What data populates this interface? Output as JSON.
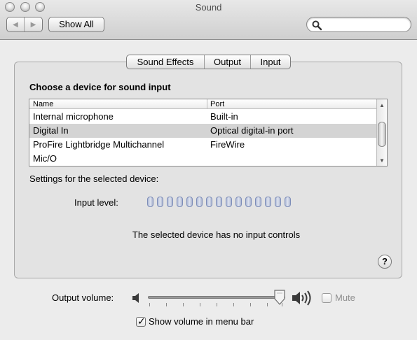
{
  "window": {
    "title": "Sound"
  },
  "toolbar": {
    "back_label": "◀",
    "forward_label": "▶",
    "show_all_label": "Show All",
    "search": {
      "value": "",
      "placeholder": ""
    }
  },
  "tabs": [
    {
      "label": "Sound Effects",
      "selected": false
    },
    {
      "label": "Output",
      "selected": false
    },
    {
      "label": "Input",
      "selected": true
    }
  ],
  "input": {
    "heading": "Choose a device for sound input",
    "table": {
      "columns": [
        "Name",
        "Port"
      ],
      "rows": [
        {
          "name": "Internal microphone",
          "port": "Built-in"
        },
        {
          "name": "Digital In",
          "port": "Optical digital-in port",
          "selected": true
        },
        {
          "name": "ProFire Lightbridge Multichannel",
          "port": "FireWire"
        },
        {
          "name": "Mic/O",
          "port": ""
        }
      ]
    },
    "settings_label": "Settings for the selected device:",
    "input_level_label": "Input level:",
    "input_level": {
      "segments": 15,
      "lit": 0
    },
    "no_controls_text": "The selected device has no input controls"
  },
  "help_label": "?",
  "output": {
    "volume_label": "Output volume:",
    "volume_fraction": 0.96,
    "mute_label": "Mute",
    "mute_checked": false,
    "show_in_menubar_label": "Show volume in menu bar",
    "show_in_menubar_checked": true
  },
  "icons": {
    "search": "magnifier-icon",
    "speaker_low": "speaker-low-icon",
    "speaker_high": "speaker-high-icon"
  }
}
